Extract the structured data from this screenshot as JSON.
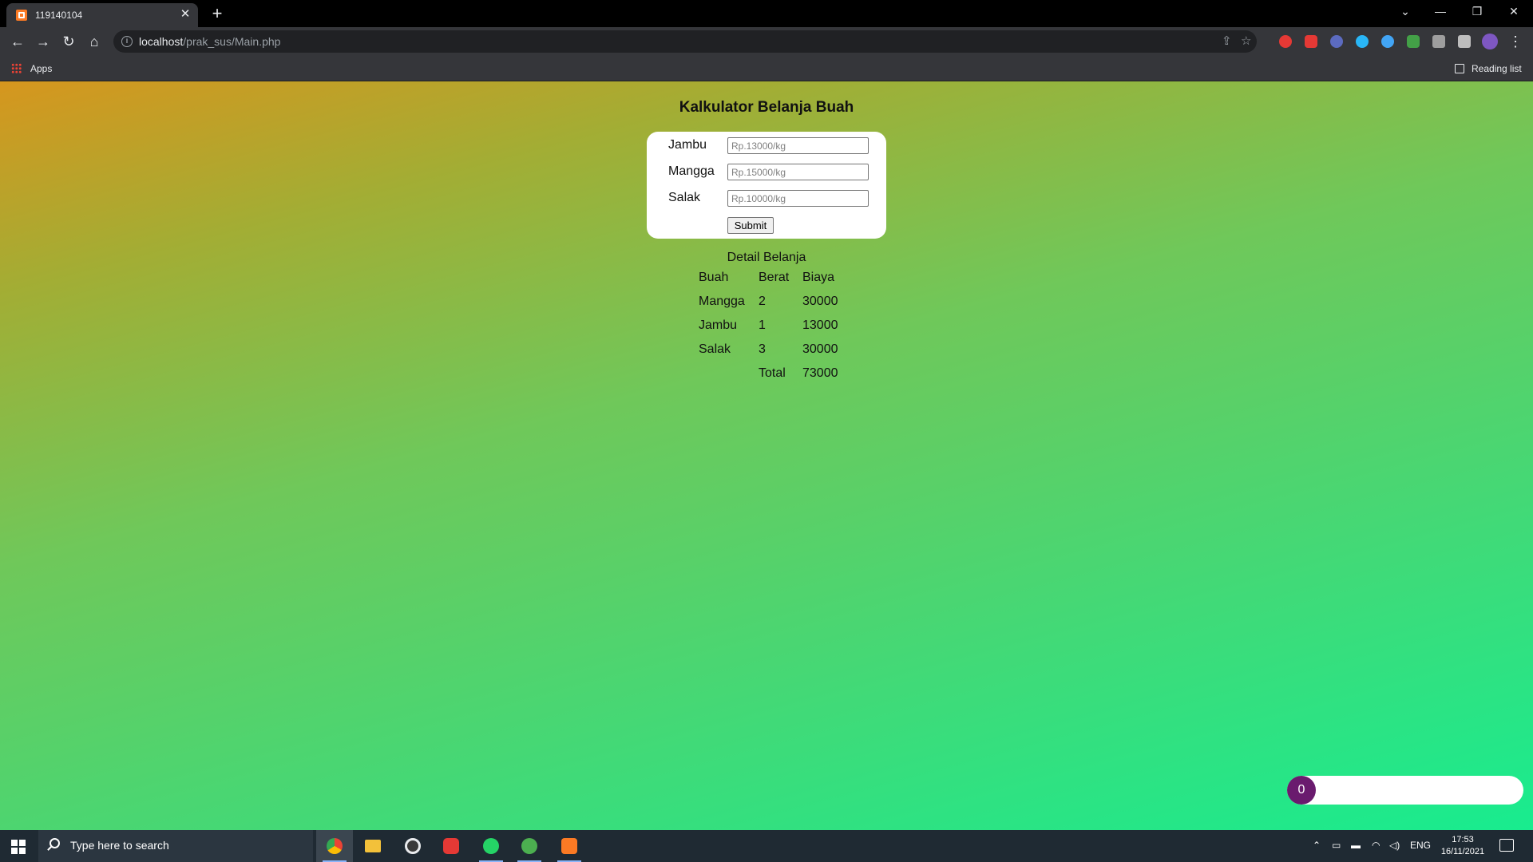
{
  "browser": {
    "tab_title": "119140104",
    "tab_close": "✕",
    "new_tab": "+",
    "url_host": "localhost",
    "url_path": "/prak_sus/Main.php",
    "bookmarks_apps": "Apps",
    "reading_list": "Reading list"
  },
  "window_controls": {
    "dropdown": "⌄",
    "minimize": "—",
    "restore": "❐",
    "close": "✕"
  },
  "page": {
    "title": "Kalkulator Belanja Buah",
    "form": {
      "fields": [
        {
          "label": "Jambu",
          "placeholder": "Rp.13000/kg"
        },
        {
          "label": "Mangga",
          "placeholder": "Rp.15000/kg"
        },
        {
          "label": "Salak",
          "placeholder": "Rp.10000/kg"
        }
      ],
      "submit": "Submit"
    },
    "detail": {
      "caption": "Detail Belanja",
      "headers": [
        "Buah",
        "Berat",
        "Biaya"
      ],
      "rows": [
        [
          "Mangga",
          "2",
          "30000"
        ],
        [
          "Jambu",
          "1",
          "13000"
        ],
        [
          "Salak",
          "3",
          "30000"
        ]
      ],
      "total_label": "Total",
      "total_value": "73000"
    }
  },
  "widget": {
    "count": "0"
  },
  "taskbar": {
    "search_placeholder": "Type here to search",
    "language": "ENG",
    "time": "17:53",
    "date": "16/11/2021"
  }
}
